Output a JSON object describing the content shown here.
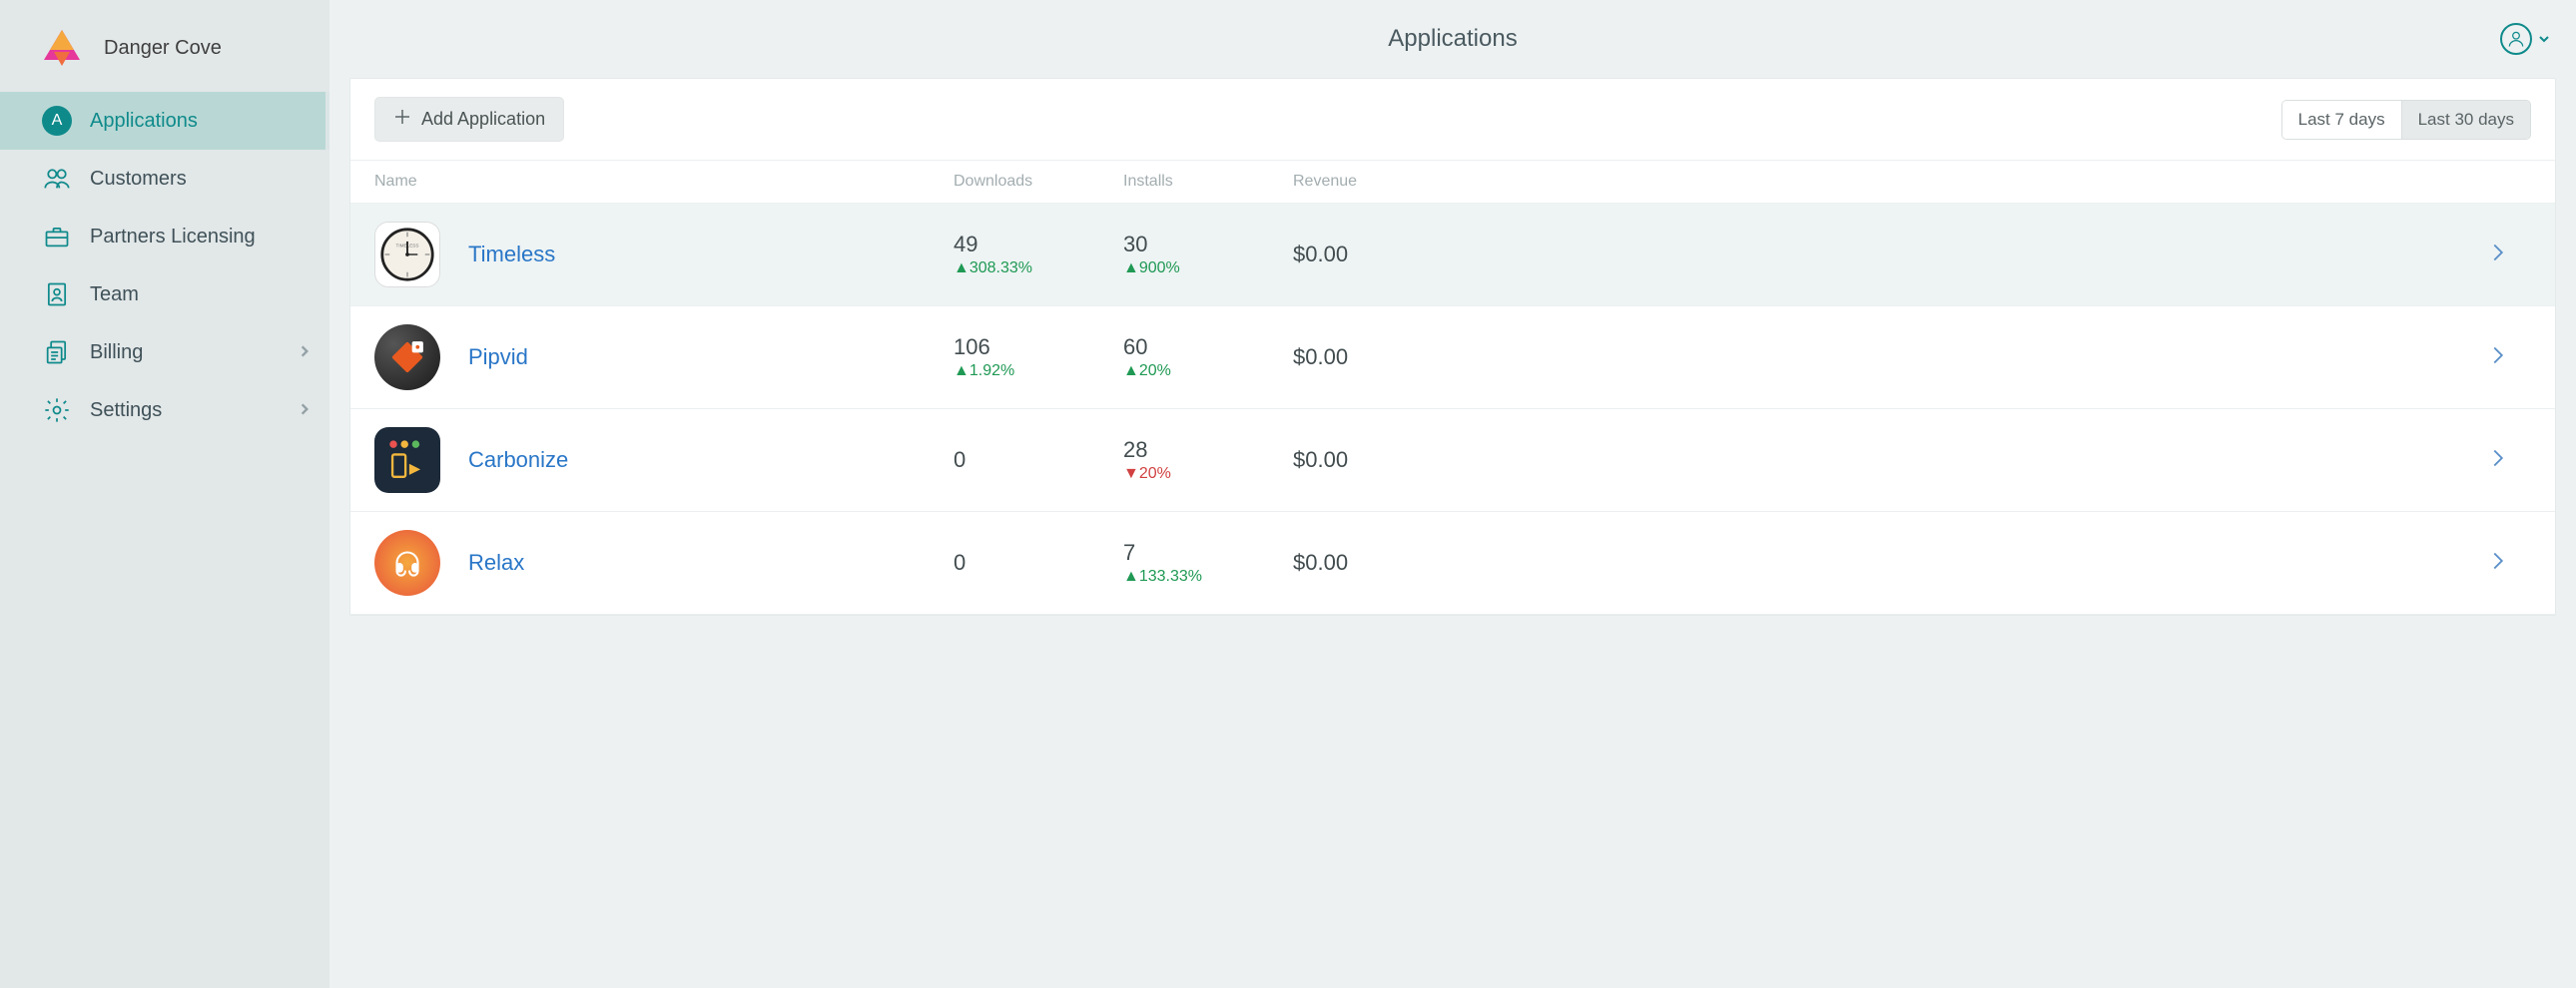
{
  "brand": {
    "name": "Danger Cove"
  },
  "sidebar": {
    "items": [
      {
        "label": "Applications",
        "badge": "A",
        "active": true,
        "chevron": false
      },
      {
        "label": "Customers",
        "active": false,
        "chevron": false
      },
      {
        "label": "Partners Licensing",
        "active": false,
        "chevron": false
      },
      {
        "label": "Team",
        "active": false,
        "chevron": false
      },
      {
        "label": "Billing",
        "active": false,
        "chevron": true
      },
      {
        "label": "Settings",
        "active": false,
        "chevron": true
      }
    ]
  },
  "header": {
    "title": "Applications"
  },
  "toolbar": {
    "add_label": "Add Application",
    "range_options": [
      {
        "label": "Last 7 days",
        "active": false
      },
      {
        "label": "Last 30 days",
        "active": true
      }
    ]
  },
  "table": {
    "columns": {
      "name": "Name",
      "downloads": "Downloads",
      "installs": "Installs",
      "revenue": "Revenue"
    },
    "rows": [
      {
        "name": "Timeless",
        "highlighted": true,
        "downloads": {
          "value": "49",
          "change": "308.33%",
          "dir": "up"
        },
        "installs": {
          "value": "30",
          "change": "900%",
          "dir": "up"
        },
        "revenue": "$0.00"
      },
      {
        "name": "Pipvid",
        "highlighted": false,
        "downloads": {
          "value": "106",
          "change": "1.92%",
          "dir": "up"
        },
        "installs": {
          "value": "60",
          "change": "20%",
          "dir": "up"
        },
        "revenue": "$0.00"
      },
      {
        "name": "Carbonize",
        "highlighted": false,
        "downloads": {
          "value": "0",
          "change": "",
          "dir": ""
        },
        "installs": {
          "value": "28",
          "change": "20%",
          "dir": "down"
        },
        "revenue": "$0.00"
      },
      {
        "name": "Relax",
        "highlighted": false,
        "downloads": {
          "value": "0",
          "change": "",
          "dir": ""
        },
        "installs": {
          "value": "7",
          "change": "133.33%",
          "dir": "up"
        },
        "revenue": "$0.00"
      }
    ]
  }
}
